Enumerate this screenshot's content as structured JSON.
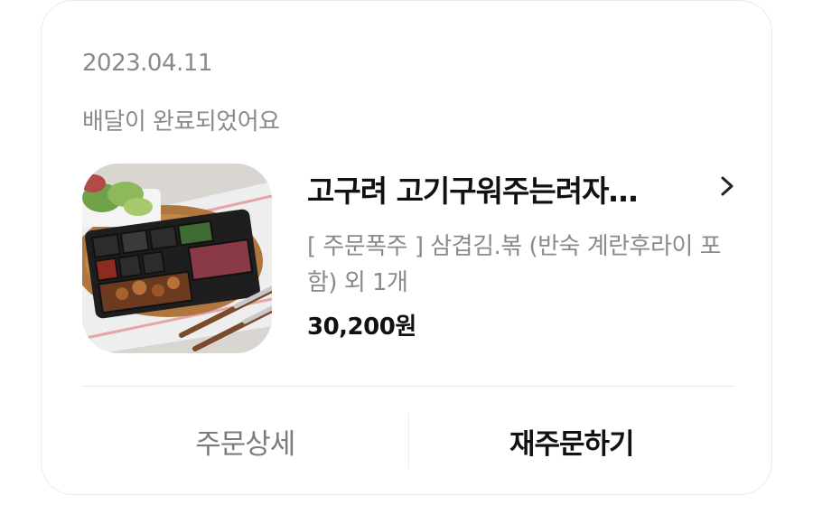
{
  "order": {
    "date": "2023.04.11",
    "status": "배달이 완료되었어요",
    "store_name": "고구려 고기구워주는려자…",
    "menu_description": "[ 주문폭주 ] 삼겹김.볶 (반숙 계란후라이 포함) 외 1개",
    "price": "30,200원",
    "thumbnail_icon": "food-tray-image"
  },
  "actions": {
    "detail_label": "주문상세",
    "reorder_label": "재주문하기"
  },
  "colors": {
    "muted_text": "#8a8a8a",
    "primary_text": "#111111",
    "border": "#ececec"
  }
}
